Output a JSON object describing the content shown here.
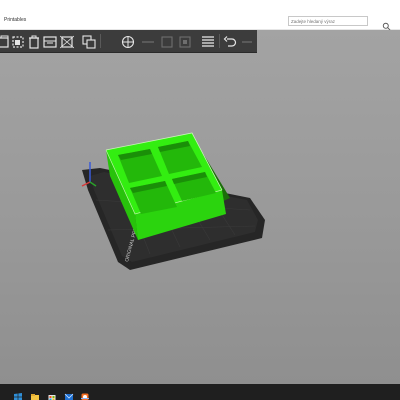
{
  "window": {
    "tab_title": "Printables"
  },
  "search": {
    "placeholder": "Zadejte hledaný výraz"
  },
  "toolbar": {
    "icons": [
      "add-object-icon",
      "arrange-icon",
      "delete-icon",
      "delete-all-icon",
      "split-icon",
      "copy-icon",
      "variable-layer-icon",
      "cut-icon",
      "paste-icon",
      "layers-icon",
      "undo-icon"
    ]
  },
  "bed": {
    "label": "ORIGINAL PRUSA MINI"
  },
  "model": {
    "color": "#33ee11",
    "cells": "2x2"
  },
  "colors": {
    "toolbar": "#3c3c3c",
    "viewport": "#9e9e9e",
    "bed": "#262626",
    "model": "#33ee11",
    "taskbar": "#1f1f1f"
  },
  "taskbar": {
    "icons": [
      "start-icon",
      "file-explorer-icon",
      "store-icon",
      "mail-icon",
      "camera-icon",
      "prusaslicer-icon"
    ]
  }
}
